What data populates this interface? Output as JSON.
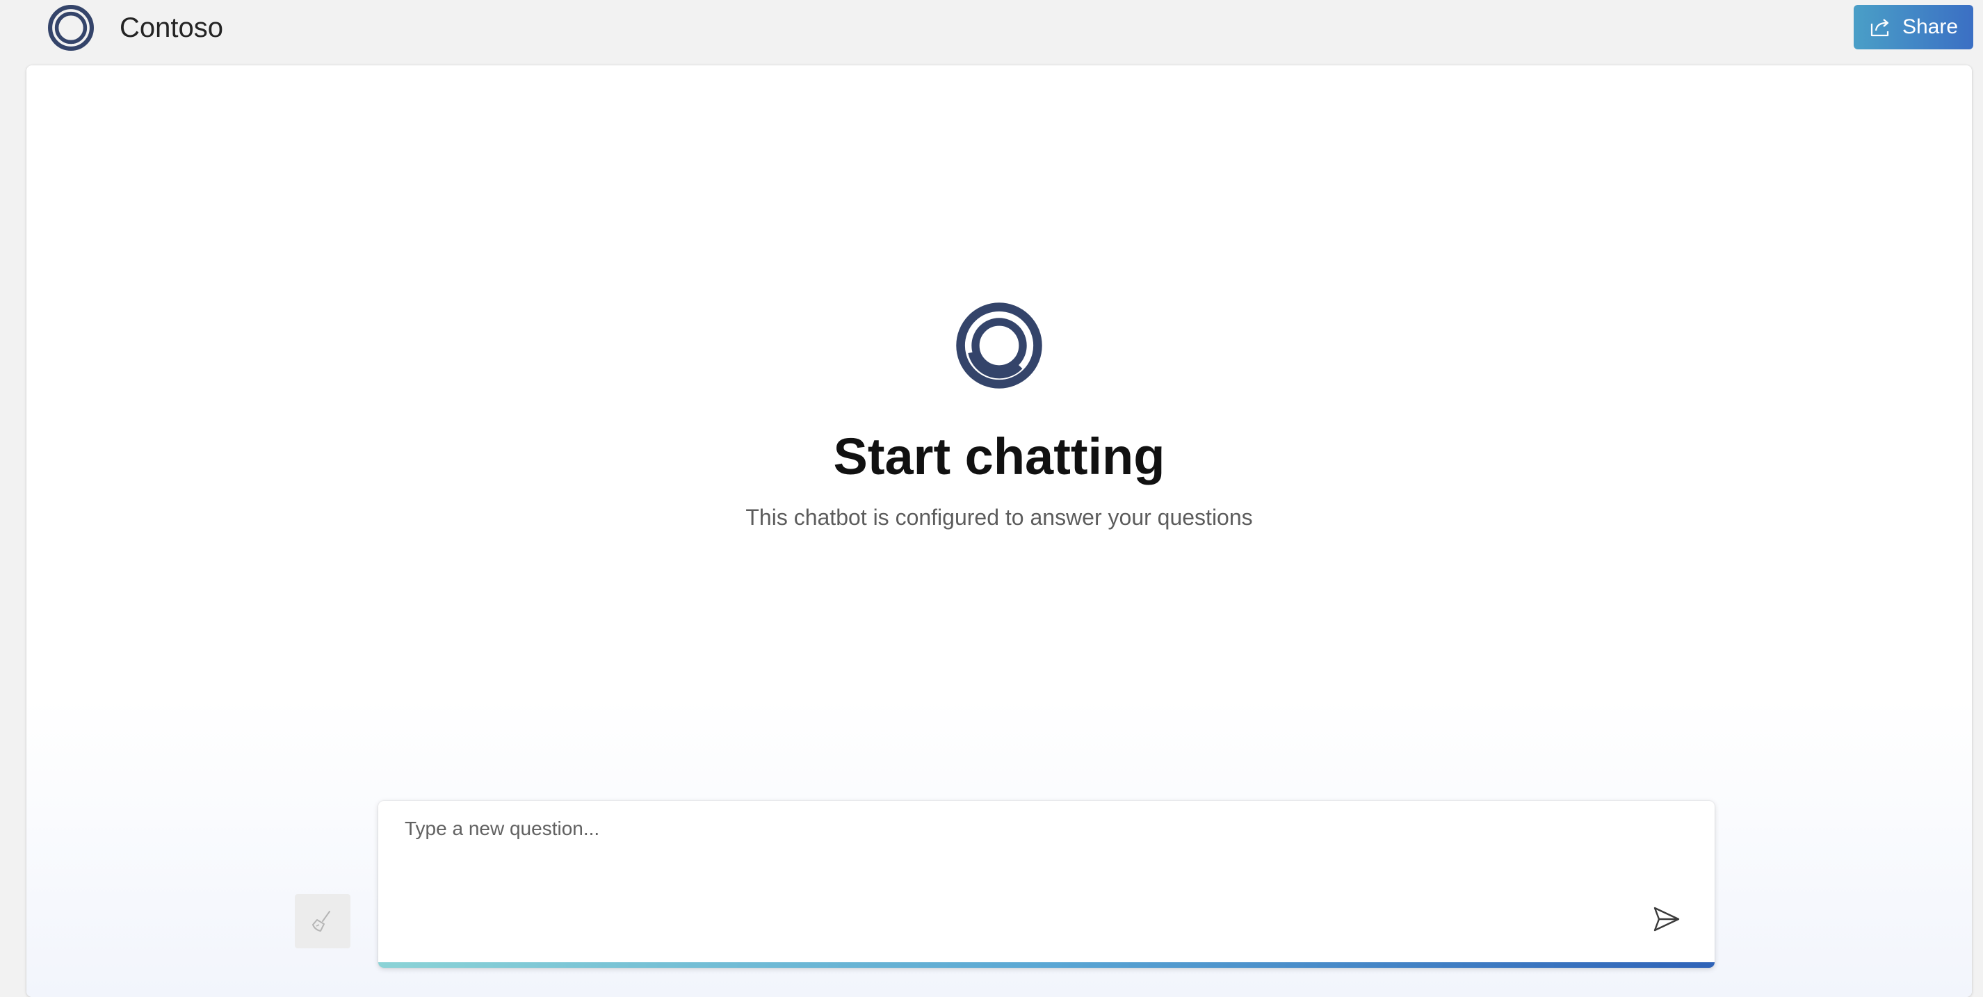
{
  "header": {
    "app_title": "Contoso",
    "logo_icon": "contoso-ring-logo",
    "share_label": "Share",
    "share_icon": "share-icon",
    "share_gradient": [
      "#4a9fc7",
      "#3b6fc4"
    ]
  },
  "hero": {
    "icon": "contoso-ring-logo",
    "title": "Start chatting",
    "subtitle": "This chatbot is configured to answer your questions"
  },
  "composer": {
    "placeholder": "Type a new question...",
    "value": "",
    "send_icon": "send-icon",
    "clear_icon": "broom-icon"
  },
  "colors": {
    "brand": "#34446a",
    "accent_bar": [
      "#8bd3d6",
      "#5aa7d4",
      "#2f63b8"
    ]
  }
}
